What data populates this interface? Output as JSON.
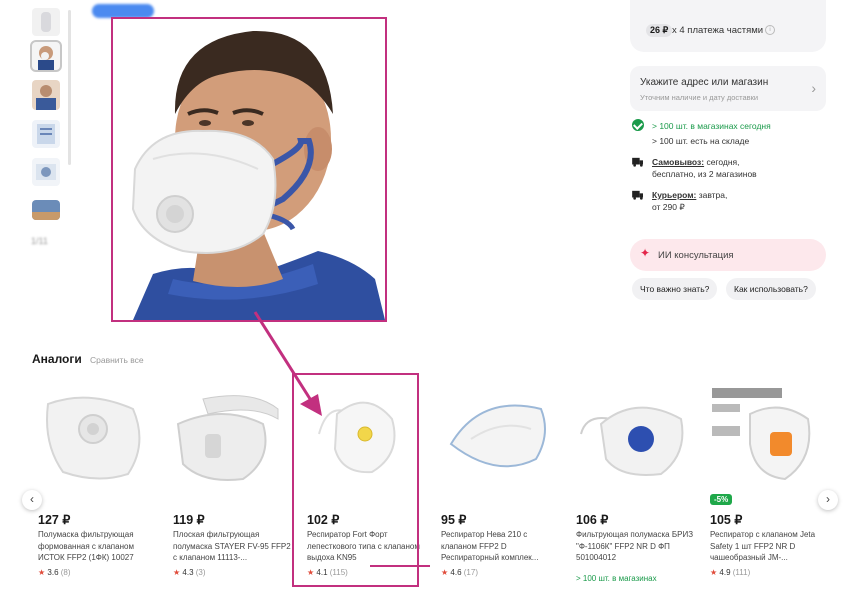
{
  "gallery": {
    "counter": "1/11"
  },
  "right_panel": {
    "installment_price": "26 ₽",
    "installment_text": "х 4 платежа частями",
    "address": {
      "title": "Укажите адрес или магазин",
      "subtitle": "Уточним наличие и дату доставки"
    },
    "stock_stores": "> 100 шт. в магазинах сегодня",
    "stock_warehouse": "> 100 шт. есть на складе",
    "pickup": {
      "label": "Самовывоз:",
      "text": " сегодня,",
      "text2": "бесплатно, из 2 магазинов"
    },
    "courier": {
      "label": "Курьером:",
      "text": " завтра,",
      "text2": "от 290 ₽"
    },
    "ai_consult": "ИИ консультация",
    "chips": [
      "Что важно знать?",
      "Как использовать?"
    ]
  },
  "analogs": {
    "title": "Аналоги",
    "compare": "Сравнить все",
    "products": [
      {
        "price": "127 ₽",
        "name": "Полумаска фильтрующая формованная с клапаном ИСТОК FFP2 (1ФК) 10027",
        "rating": "3.6",
        "reviews": "(8)"
      },
      {
        "price": "119 ₽",
        "name": "Плоская фильтрующая полумаска STAYER FV-95 FFP2 с клапаном 11113-...",
        "rating": "4.3",
        "reviews": "(3)"
      },
      {
        "price": "102 ₽",
        "name": "Респиратор Fort Форт лепесткового типа с клапаном выдоха KN95",
        "rating": "4.1",
        "reviews": "(115)"
      },
      {
        "price": "95 ₽",
        "name": "Респиратор Нева 210 с клапаном FFP2 D Респираторный комплек...",
        "rating": "4.6",
        "reviews": "(17)"
      },
      {
        "price": "106 ₽",
        "name": "Фильтрующая полумаска БРИЗ \"Ф-1106К\" FFP2 NR D ФП 501004012",
        "avail": "> 100 шт. в магазинах"
      },
      {
        "price": "105 ₽",
        "discount": "-5%",
        "name": "Респиратор с клапаном Jeta Safety 1 шт FFP2 NR D чашеобразный JM-...",
        "rating": "4.9",
        "reviews": "(111)"
      }
    ]
  },
  "colors": {
    "highlight": "#c2307f",
    "accent_green": "#1a9a4a",
    "star": "#e04b3a"
  }
}
